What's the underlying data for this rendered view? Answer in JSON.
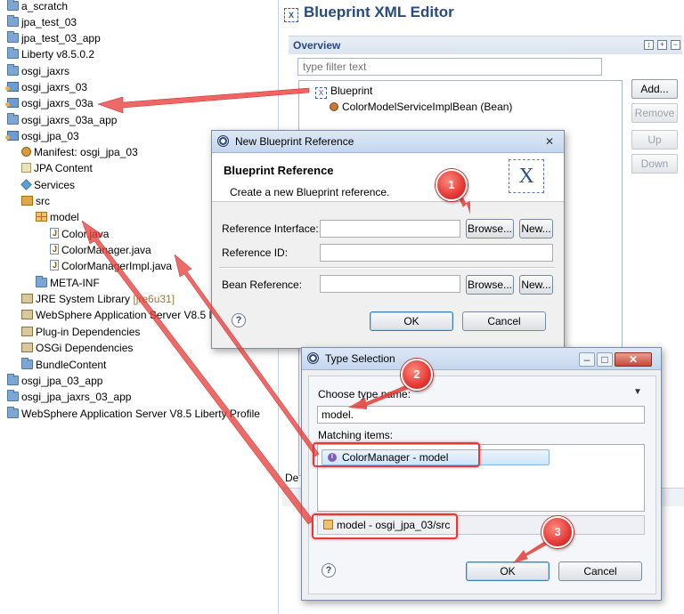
{
  "explorer": {
    "items": [
      {
        "label": "a_scratch",
        "icon": "folder-icon"
      },
      {
        "label": "jpa_test_03",
        "icon": "folder-icon"
      },
      {
        "label": "jpa_test_03_app",
        "icon": "folder-icon"
      },
      {
        "label": "Liberty v8.5.0.2",
        "icon": "folder-icon"
      },
      {
        "label": "osgi_jaxrs",
        "icon": "folder-icon"
      },
      {
        "label": "osgi_jaxrs_03",
        "icon": "project-icon"
      },
      {
        "label": "osgi_jaxrs_03a",
        "icon": "project-icon"
      },
      {
        "label": "osgi_jaxrs_03a_app",
        "icon": "folder-icon"
      },
      {
        "label": "osgi_jpa_03",
        "icon": "project-icon"
      },
      {
        "label": "Manifest: osgi_jpa_03",
        "icon": "manifest-icon"
      },
      {
        "label": "JPA Content",
        "icon": "jpa-icon"
      },
      {
        "label": "Services",
        "icon": "services-icon"
      },
      {
        "label": "src",
        "icon": "source-folder-icon"
      },
      {
        "label": "model",
        "icon": "package-icon"
      },
      {
        "label": "Color.java",
        "icon": "java-file-icon"
      },
      {
        "label": "ColorManager.java",
        "icon": "java-file-icon"
      },
      {
        "label": "ColorManagerImpl.java",
        "icon": "java-file-icon"
      },
      {
        "label": "META-INF",
        "icon": "folder-icon"
      },
      {
        "label": "JRE System Library",
        "decoration": "[jre6u31]",
        "icon": "library-icon"
      },
      {
        "label": "WebSphere Application Server V8.5 L",
        "icon": "library-icon"
      },
      {
        "label": "Plug-in Dependencies",
        "icon": "library-icon"
      },
      {
        "label": "OSGi Dependencies",
        "icon": "library-icon"
      },
      {
        "label": "BundleContent",
        "icon": "folder-icon"
      },
      {
        "label": "osgi_jpa_03_app",
        "icon": "folder-icon"
      },
      {
        "label": "osgi_jpa_jaxrs_03_app",
        "icon": "folder-icon"
      },
      {
        "label": "WebSphere Application Server V8.5 Liberty Profile",
        "icon": "folder-icon"
      }
    ]
  },
  "editor": {
    "title": "Blueprint XML Editor",
    "overview_label": "Overview",
    "filter_placeholder": "type filter text",
    "tree": [
      {
        "label": "Blueprint"
      },
      {
        "label": "ColorModelServiceImplBean (Bean)"
      }
    ],
    "buttons": {
      "add": "Add...",
      "remove": "Remove",
      "up": "Up",
      "down": "Down"
    },
    "details_tab": "De"
  },
  "new_ref_dialog": {
    "title": "New Blueprint Reference",
    "heading": "Blueprint Reference",
    "description": "Create a new Blueprint reference.",
    "reference_interface_label": "Reference Interface:",
    "reference_id_label": "Reference ID:",
    "bean_reference_label": "Bean Reference:",
    "browse_label": "Browse...",
    "new_label": "New...",
    "ok_label": "OK",
    "cancel_label": "Cancel"
  },
  "type_dialog": {
    "title": "Type Selection",
    "choose_label": "Choose type name:",
    "type_value": "model.",
    "matching_label": "Matching items:",
    "matching_items": [
      {
        "label": "ColorManager - model"
      }
    ],
    "status_item": "model - osgi_jpa_03/src",
    "ok_label": "OK",
    "cancel_label": "Cancel"
  },
  "callouts": [
    "1",
    "2",
    "3"
  ],
  "colors": {
    "annotation": "#e53935",
    "title_blue": "#284a80"
  }
}
